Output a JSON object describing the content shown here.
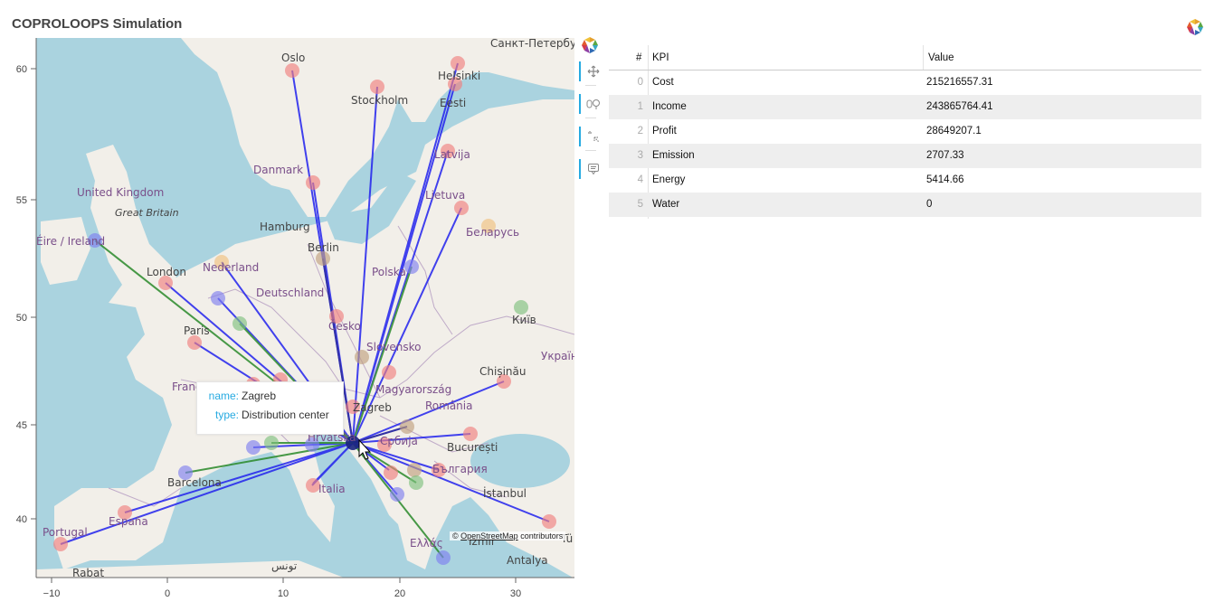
{
  "app": {
    "title": "COPROLOOPS Simulation"
  },
  "map": {
    "attribution_prefix": "©",
    "attribution_link": "OpenStreetMap",
    "attribution_suffix": "contributors",
    "x_ticks": [
      "−10",
      "0",
      "10",
      "20",
      "30"
    ],
    "y_ticks": [
      "60",
      "55",
      "50",
      "45",
      "40"
    ],
    "labels": [
      "Oslo",
      "Stockholm",
      "Helsinki",
      "Санкт-Петербург",
      "Eesti",
      "Latvija",
      "Danmark",
      "Lietuva",
      "United Kingdom",
      "Great Britain",
      "Hamburg",
      "Беларусь",
      "Éire / Ireland",
      "Berlin",
      "London",
      "Nederland",
      "Polska",
      "Deutschland",
      "Київ",
      "Česko",
      "Paris",
      "Slovensko",
      "Україна",
      "France",
      "Magyarország",
      "Chișinău",
      "Zagreb",
      "România",
      "Hrvatska",
      "Србија",
      "București",
      "Barcelona",
      "България",
      "Italia",
      "İstanbul",
      "España",
      "Portugal",
      "Ελλάς",
      "İzmir",
      "Antalya",
      "Rabat",
      "تونس",
      "Tü"
    ]
  },
  "tooltip": {
    "name_key": "name:",
    "name_value": "Zagreb",
    "type_key": "type:",
    "type_value": "Distribution center"
  },
  "toolbar": {
    "tools": [
      {
        "name": "bokeh-logo-icon"
      },
      {
        "name": "pan-tool-icon"
      },
      {
        "name": "wheel-zoom-tool-icon"
      },
      {
        "name": "tap-tool-icon"
      },
      {
        "name": "hover-tool-icon"
      }
    ]
  },
  "kpi_table": {
    "headers": {
      "index": "#",
      "kpi": "KPI",
      "value": "Value"
    },
    "rows": [
      {
        "index": "0",
        "kpi": "Cost",
        "value": "215216557.31"
      },
      {
        "index": "1",
        "kpi": "Income",
        "value": "243865764.41"
      },
      {
        "index": "2",
        "kpi": "Profit",
        "value": "28649207.1"
      },
      {
        "index": "3",
        "kpi": "Emission",
        "value": "2707.33"
      },
      {
        "index": "4",
        "kpi": "Energy",
        "value": "5414.66"
      },
      {
        "index": "5",
        "kpi": "Water",
        "value": "0"
      }
    ]
  },
  "colors": {
    "route_blue": "#2222ee",
    "route_green": "#2a8a2a",
    "sea": "#aad3df",
    "land": "#f2efe9",
    "accent": "#26aae1"
  }
}
